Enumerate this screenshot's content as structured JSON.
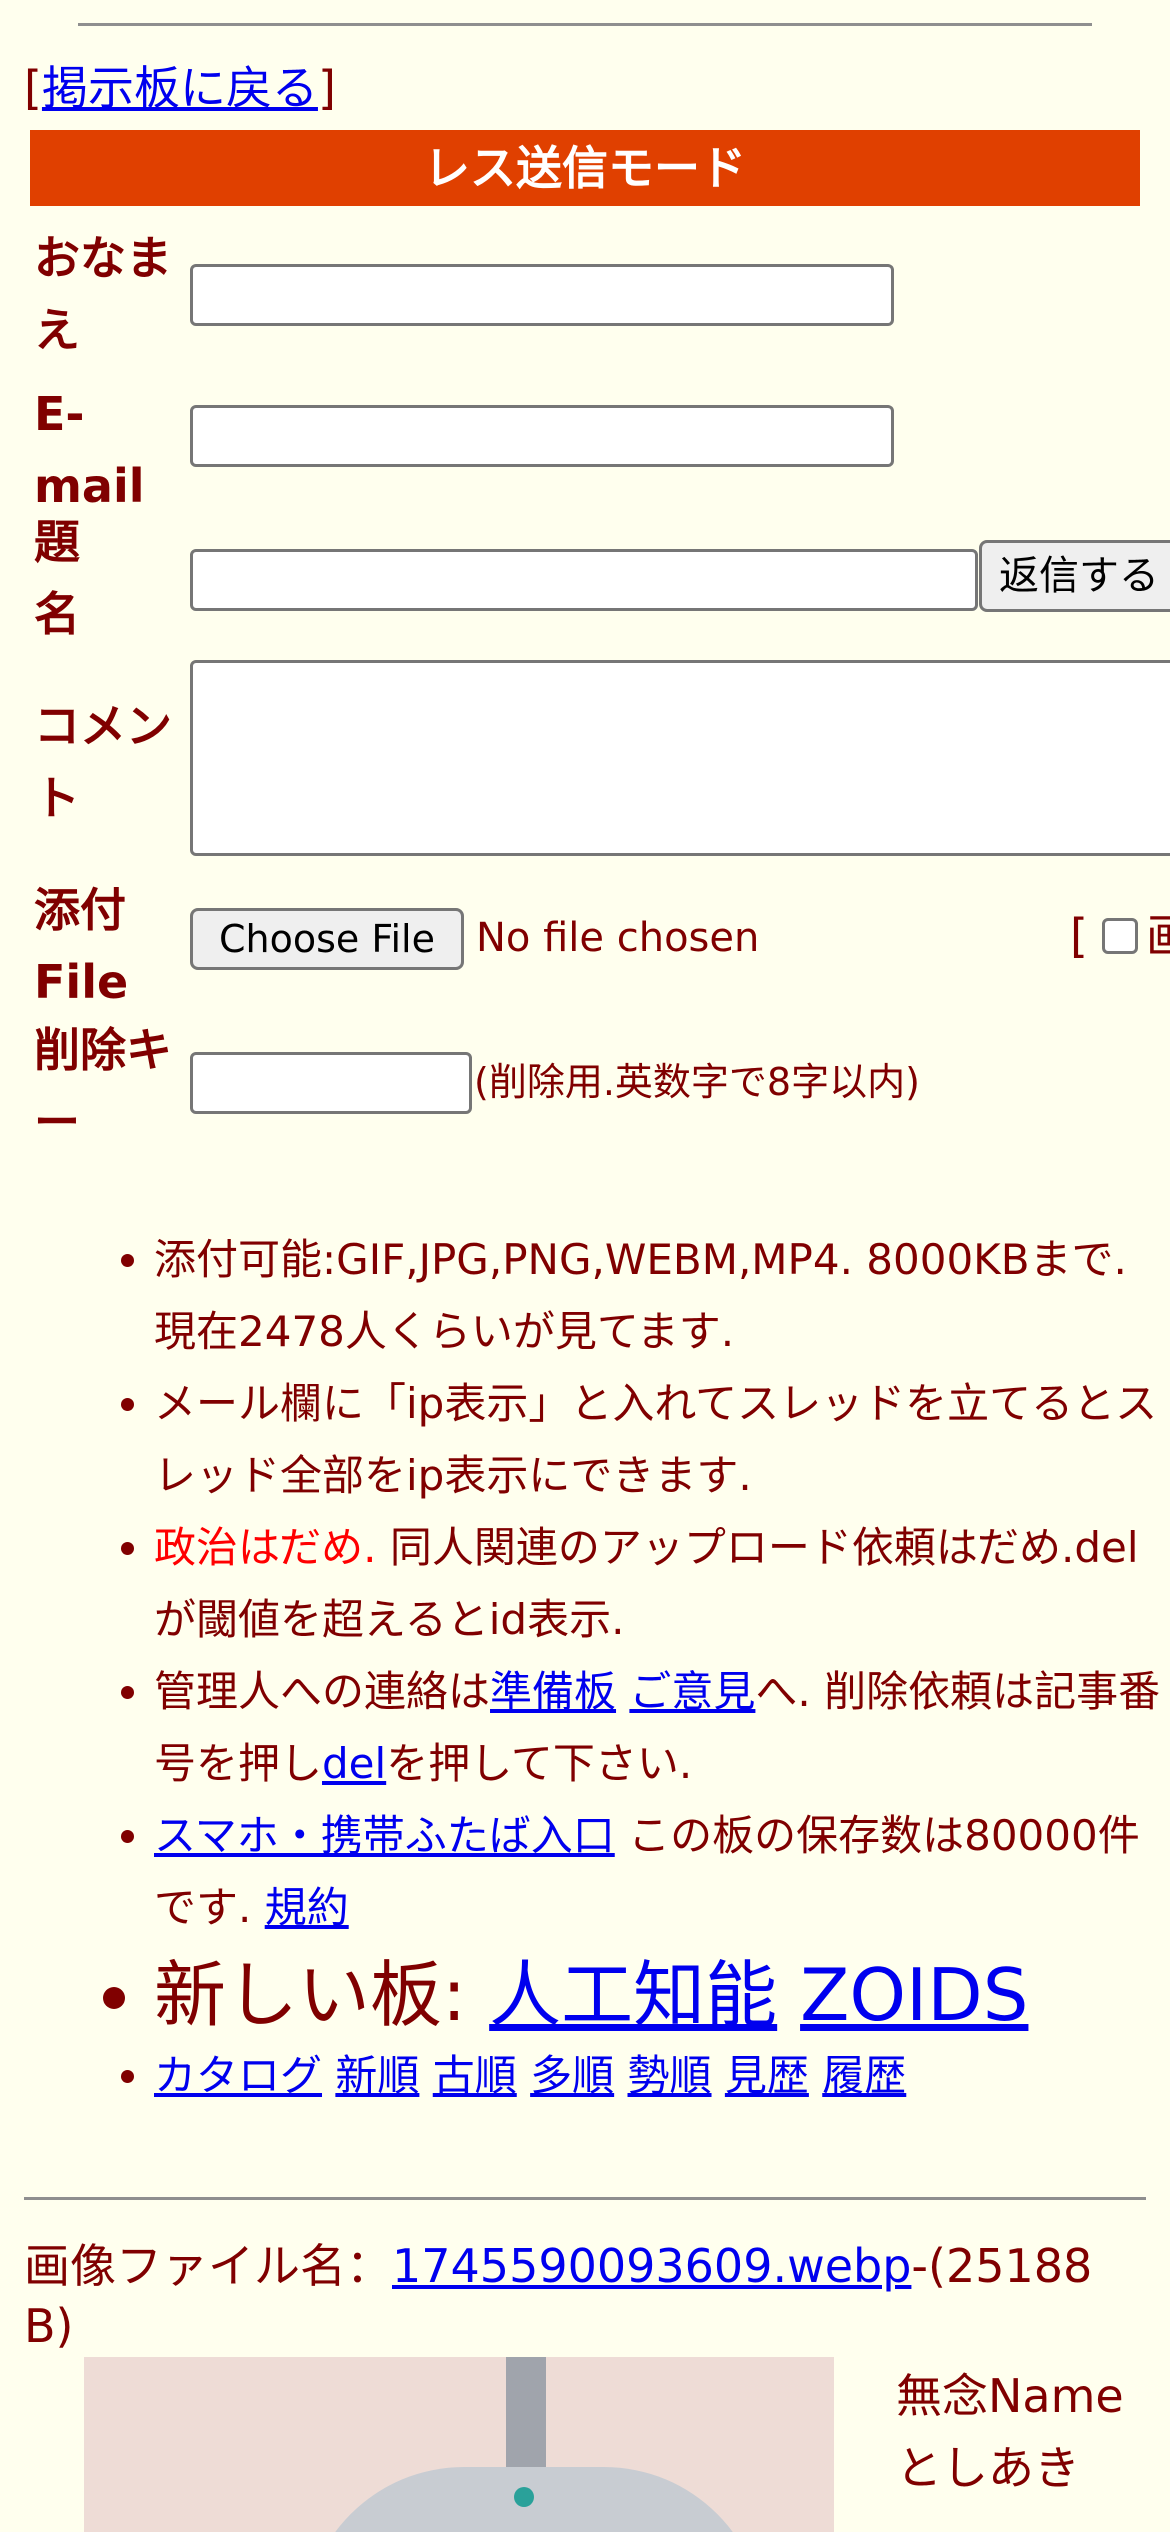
{
  "back_link": {
    "open": "[",
    "label": "掲示板に戻る",
    "close": "]"
  },
  "mode_title": "レス送信モード",
  "form": {
    "name_label_1": "おなま",
    "name_label_2": "え",
    "email_label_1": "E-",
    "email_label_2": "mail",
    "subject_label_1": "題",
    "subject_label_2": "名",
    "submit_button": "返信する",
    "comment_label_1": "コメン",
    "comment_label_2": "ト",
    "file_label_1": "添付",
    "file_label_2": "File",
    "choose_file_button": "Choose File",
    "no_file_text": "No file chosen",
    "image_option_bracket": "[",
    "image_option_label_partial": "画",
    "delkey_label_1": "削除キ",
    "delkey_label_2": "ー",
    "delkey_note": "(削除用.英数字で8字以内)"
  },
  "rules": {
    "r1": "添付可能:GIF,JPG,PNG,WEBM,MP4. 8000KBまで. 現在2478人くらいが見てます.",
    "r2": "メール欄に「ip表示」と入れてスレッドを立てるとスレッド全部をip表示にできます.",
    "r3_red": "政治はだめ.",
    "r3_rest": " 同人関連のアップロード依頼はだめ.delが閾値を超えるとid表示.",
    "r4_a": "管理人への連絡は",
    "r4_link1": "準備板",
    "r4_link2": "ご意見",
    "r4_b": "へ. 削除依頼は記事番号を押し",
    "r4_link3": "del",
    "r4_c": "を押して下さい.",
    "r5_link1": "スマホ・携帯ふたば入口",
    "r5_a": " この板の保存数は80000件です. ",
    "r5_link2": "規約",
    "r6_label": "新しい板: ",
    "r6_link1": "人工知能",
    "r6_link2": "ZOIDS",
    "nav": [
      "カタログ",
      "新順",
      "古順",
      "多順",
      "勢順",
      "見歴",
      "履歴"
    ]
  },
  "post": {
    "file_label": "画像ファイル名：",
    "file_name": "1745590093609.webp",
    "file_size": "-(25188 B)",
    "poster_line1": "無念Name",
    "poster_line2": "としあき"
  }
}
